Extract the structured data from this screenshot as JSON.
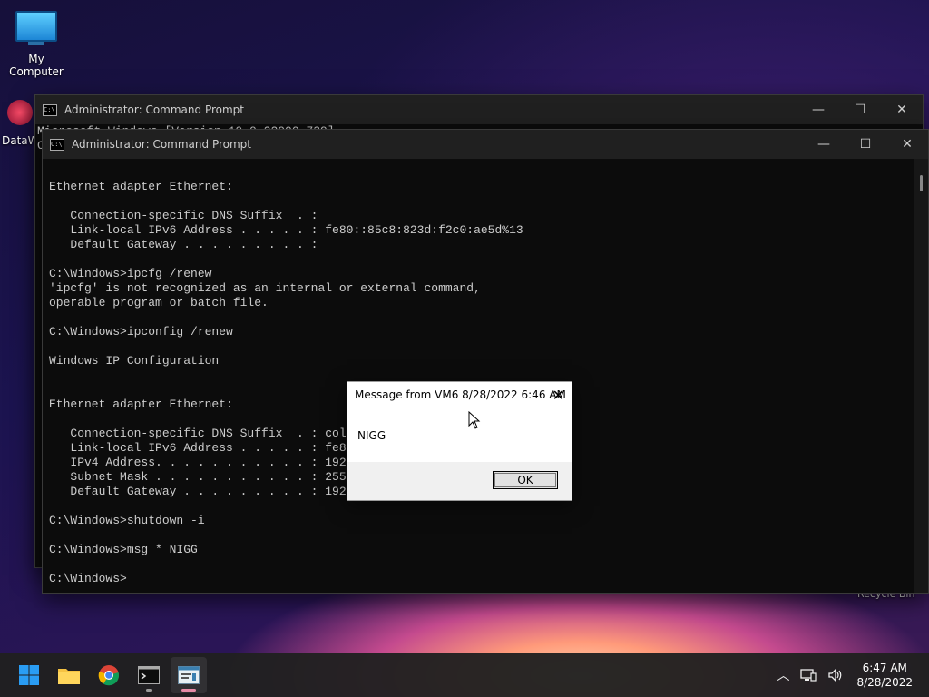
{
  "desktop": {
    "my_computer_label": "My Computer",
    "dataw_label": "DataW",
    "recycle_label": "Recycle Bin"
  },
  "back_window": {
    "title": "Administrator: Command Prompt",
    "first_line": "Microsoft Windows [Version 10.0.22000.739]",
    "second_line_char": "C"
  },
  "front_window": {
    "title": "Administrator: Command Prompt",
    "console": "\nEthernet adapter Ethernet:\n\n   Connection-specific DNS Suffix  . :\n   Link-local IPv6 Address . . . . . : fe80::85c8:823d:f2c0:ae5d%13\n   Default Gateway . . . . . . . . . :\n\nC:\\Windows>ipcfg /renew\n'ipcfg' is not recognized as an internal or external command,\noperable program or batch file.\n\nC:\\Windows>ipconfig /renew\n\nWindows IP Configuration\n\n\nEthernet adapter Ethernet:\n\n   Connection-specific DNS Suffix  . : col\n   Link-local IPv6 Address . . . . . : fe8\n   IPv4 Address. . . . . . . . . . . : 192\n   Subnet Mask . . . . . . . . . . . : 255\n   Default Gateway . . . . . . . . . : 192.168.1.1\n\nC:\\Windows>shutdown -i\n\nC:\\Windows>msg * NIGG\n\nC:\\Windows>"
  },
  "dialog": {
    "title": "Message from VM6 8/28/2022 6:46 AM",
    "message": "NIGG",
    "ok_label": "OK"
  },
  "taskbar": {
    "time": "6:47 AM",
    "date": "8/28/2022",
    "icons": [
      "start-icon",
      "file-explorer-icon",
      "chrome-icon",
      "terminal-icon",
      "app-icon"
    ]
  },
  "colors": {
    "console_bg": "#0c0c0c",
    "console_text": "#cccccc",
    "titlebar": "#202020",
    "taskbar": "#202020",
    "start_blue": "#1e90ff",
    "active_indicator": "#e68aa6"
  }
}
